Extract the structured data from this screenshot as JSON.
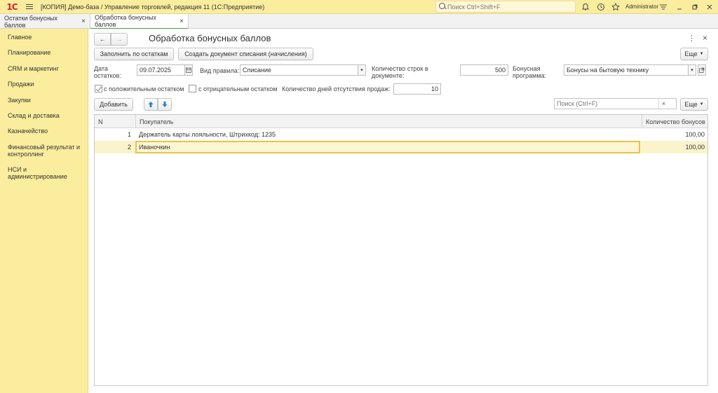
{
  "app": {
    "logo": "1С",
    "title": "[КОПИЯ] Демо-база / Управление торговлей, редакция 11  (1С:Предприятие)",
    "search_placeholder": "Поиск Ctrl+Shift+F",
    "user": "Administrator",
    "icons": [
      "bell-icon",
      "history-icon",
      "star-icon",
      "settings-menu-icon",
      "minimize-icon",
      "restore-icon",
      "close-icon"
    ]
  },
  "tabs": [
    {
      "label": "Остатки бонусных баллов",
      "close": "×"
    },
    {
      "label": "Обработка бонусных баллов",
      "close": "×",
      "active": true
    }
  ],
  "sidebar": {
    "items": [
      {
        "label": "Главное"
      },
      {
        "label": "Планирование"
      },
      {
        "label": "CRM и маркетинг"
      },
      {
        "label": "Продажи"
      },
      {
        "label": "Закупки"
      },
      {
        "label": "Склад и доставка"
      },
      {
        "label": "Казначейство"
      },
      {
        "label": "Финансовый результат и контроллинг"
      },
      {
        "label": "НСИ и администрирование"
      }
    ]
  },
  "form": {
    "title": "Обработка бонусных баллов",
    "nav_back": "←",
    "nav_forward": "→",
    "more_menu": "⋮",
    "close": "×",
    "btn_fill": "Заполнить по остаткам",
    "btn_create_doc": "Создать документ списания (начисления)",
    "btn_more": "Еще",
    "date_label": "Дата остатков:",
    "date_value": "09.07.2025",
    "rule_label": "Вид правила:",
    "rule_value": "Списание",
    "rows_label": "Количество строк в документе:",
    "rows_value": "500",
    "program_label": "Бонусная программа:",
    "program_value": "Бонусы на бытовую технику",
    "positive_label": "с положительным остатком",
    "positive_checked": true,
    "negative_label": "с отрицательным остатком",
    "negative_checked": false,
    "days_label": "Количество дней отсутствия продаж:",
    "days_value": "10",
    "btn_add": "Добавить",
    "btn_more2": "Еще",
    "search_placeholder": "Поиск (Ctrl+F)",
    "search_clear": "×"
  },
  "table": {
    "columns": {
      "n": "N",
      "buyer": "Покупатель",
      "bonus": "Количество бонусов"
    },
    "rows": [
      {
        "n": "1",
        "buyer": "Держатель карты лояльности, Штрихкод: 1235",
        "bonus": "100,00"
      },
      {
        "n": "2",
        "buyer": "Иваночкин",
        "bonus": "100,00",
        "selected": true
      }
    ]
  },
  "colors": {
    "accent_yellow": "#fbed9e",
    "active_tab_green": "#4e9f3d",
    "selection": "#fbf3c9",
    "arrow_blue": "#2f7fd1"
  }
}
